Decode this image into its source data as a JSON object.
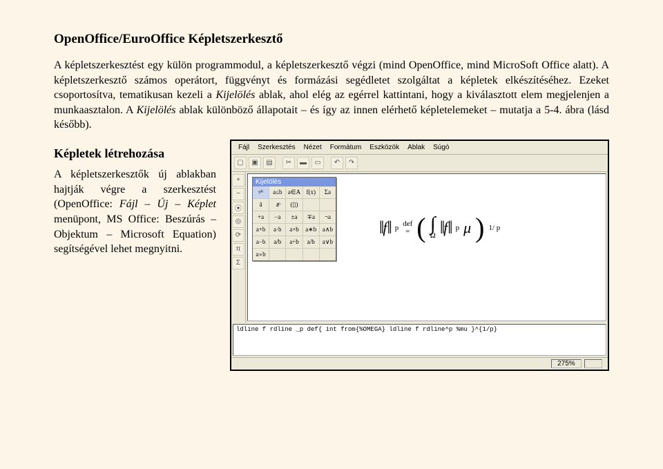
{
  "title": "OpenOffice/EuroOffice Képletszerkesztő",
  "para1_a": "A képletszerkesztést egy külön programmodul, a képletszerkesztő végzi (mind OpenOffice, mind MicroSoft Office alatt). A képletszerkesztő számos operátort, függvényt és formázási segédletet szolgáltat a képletek elkészítéséhez. Ezeket csoportosítva, tematikusan kezeli a ",
  "para1_it1": "Kijelölés",
  "para1_b": " ablak, ahol elég az egérrel kattintani, hogy a kiválasztott elem megjelenjen a munkaasztalon. A ",
  "para1_it2": "Kijelölés",
  "para1_c": " ablak különböző állapotait – és így az innen elérhető képletelemeket – mutatja a 5-4. ábra (lásd később).",
  "subhead": "Képletek létrehozása",
  "left_a": "A képletszerkesztők új ablakban hajtják végre a szerkesztést (OpenOffice: ",
  "left_it1": "Fájl – Új – Képlet",
  "left_b": " menüpont, MS Office: Beszúrás – Objektum – Microsoft Equation) segítségével lehet megnyitni.",
  "menu": {
    "m1": "Fájl",
    "m2": "Szerkesztés",
    "m3": "Nézet",
    "m4": "Formátum",
    "m5": "Eszközök",
    "m6": "Ablak",
    "m7": "Súgó"
  },
  "palette_title": "Kijelölés",
  "prow1": {
    "c1": "ᵃ⁄ᵇ",
    "c2": "a≤b",
    "c3": "a∈A",
    "c4": "f(x)",
    "c5": "Σa"
  },
  "prow2": {
    "c1": "ā",
    "c2": "aͫ",
    "c3": "(▯)",
    "c4": "",
    "c5": ""
  },
  "prow3": {
    "c1": "+a",
    "c2": "−a",
    "c3": "±a",
    "c4": "∓a",
    "c5": "¬a"
  },
  "prow4": {
    "c1": "a+b",
    "c2": "a·b",
    "c3": "a×b",
    "c4": "a∗b",
    "c5": "a∧b"
  },
  "prow5": {
    "c1": "a−b",
    "c2": "a/b",
    "c3": "a÷b",
    "c4": "a/b",
    "c5": "a∨b"
  },
  "prow6": {
    "c1": "a∘b",
    "c2": "",
    "c3": "",
    "c4": "",
    "c5": ""
  },
  "formula": {
    "def": "def",
    "eq": "=",
    "f": "f",
    "p": "p",
    "mu": "μ",
    "omega": "Ω",
    "exp": "1/ p"
  },
  "cmd": "ldline f rdline _p def{ int from{%OMEGA} ldline f rdline^p %mu }^{1/p}",
  "zoom": "275%"
}
